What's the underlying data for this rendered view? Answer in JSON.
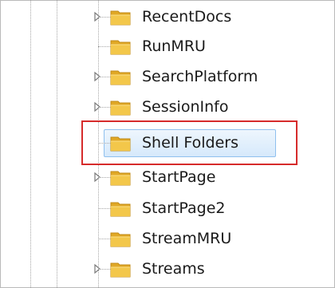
{
  "tree": {
    "items": [
      {
        "label": "RecentDocs",
        "expandable": true,
        "selected": false
      },
      {
        "label": "RunMRU",
        "expandable": false,
        "selected": false
      },
      {
        "label": "SearchPlatform",
        "expandable": true,
        "selected": false
      },
      {
        "label": "SessionInfo",
        "expandable": true,
        "selected": false
      },
      {
        "label": "Shell Folders",
        "expandable": false,
        "selected": true
      },
      {
        "label": "StartPage",
        "expandable": true,
        "selected": false
      },
      {
        "label": "StartPage2",
        "expandable": false,
        "selected": false
      },
      {
        "label": "StreamMRU",
        "expandable": false,
        "selected": false
      },
      {
        "label": "Streams",
        "expandable": true,
        "selected": false
      }
    ]
  },
  "colors": {
    "highlight_border": "#d62b2b",
    "selection_border": "#8fc0ee",
    "folder_yellow": "#f3c74a"
  }
}
